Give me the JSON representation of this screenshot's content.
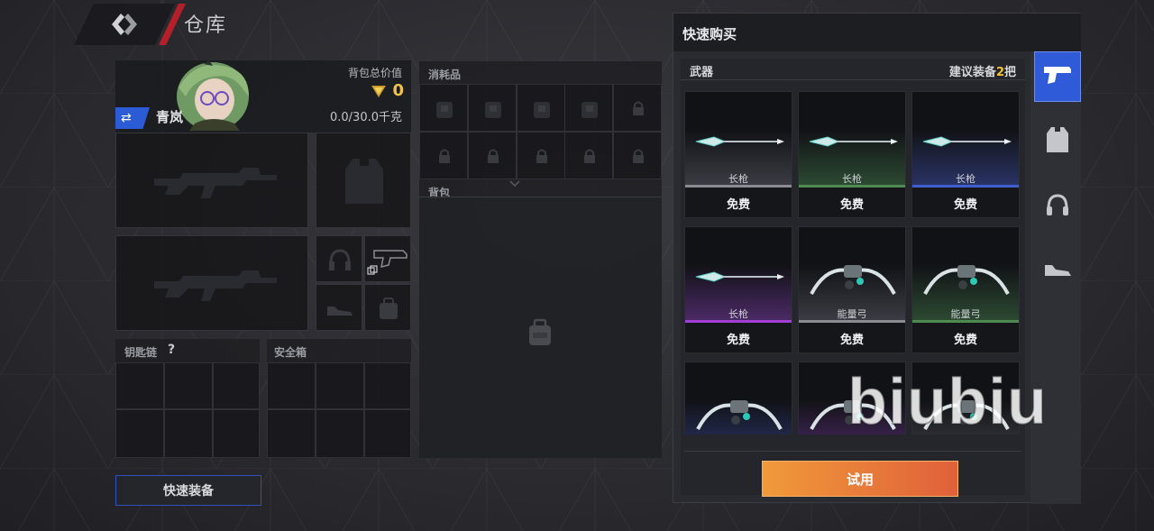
{
  "header": {
    "title": "仓库"
  },
  "character": {
    "name": "青岚",
    "value_label": "背包总价值",
    "value": "0",
    "weight": "0.0/30.0千克"
  },
  "sections": {
    "consumables": "消耗品",
    "backpack": "背包",
    "keychain": "钥匙链",
    "keychain_help": "?",
    "safebox": "安全箱"
  },
  "buttons": {
    "quick_equip": "快速装备",
    "try": "试用"
  },
  "shop": {
    "title": "快速购买",
    "category": "武器",
    "recommend_prefix": "建议装备",
    "recommend_count": "2",
    "recommend_suffix": "把",
    "items": [
      {
        "name": "长枪",
        "price": "免费",
        "rarity_color": "#8a8c92",
        "glow": "#3b3d44",
        "type": "spear"
      },
      {
        "name": "长枪",
        "price": "免费",
        "rarity_color": "#4f8a52",
        "glow": "#2c4a32",
        "type": "spear"
      },
      {
        "name": "长枪",
        "price": "免费",
        "rarity_color": "#3f5fd0",
        "glow": "#2a3466",
        "type": "spear"
      },
      {
        "name": "长枪",
        "price": "免费",
        "rarity_color": "#a23fd6",
        "glow": "#4c2a66",
        "type": "spear"
      },
      {
        "name": "能量弓",
        "price": "免费",
        "rarity_color": "#8a8c92",
        "glow": "#3b3d44",
        "type": "bow"
      },
      {
        "name": "能量弓",
        "price": "免费",
        "rarity_color": "#4f8a52",
        "glow": "#2c4a32",
        "type": "bow"
      },
      {
        "name": "",
        "price": "",
        "rarity_color": "#3f5fd0",
        "glow": "#2a3466",
        "type": "bow"
      },
      {
        "name": "",
        "price": "",
        "rarity_color": "#a23fd6",
        "glow": "#4c2a66",
        "type": "bow"
      },
      {
        "name": "",
        "price": "",
        "rarity_color": "#8a8c92",
        "glow": "#3b3d44",
        "type": "bow"
      }
    ]
  },
  "side_tabs": [
    {
      "icon": "pistol-icon",
      "active": true
    },
    {
      "icon": "vest-icon",
      "active": false
    },
    {
      "icon": "headset-icon",
      "active": false
    },
    {
      "icon": "shoe-icon",
      "active": false
    }
  ],
  "watermark": "biubiu",
  "colors": {
    "accent_blue": "#2f5bd8",
    "accent_orange": "#e87a3a",
    "gold": "#f0c24a",
    "header_red": "#b3202a"
  }
}
